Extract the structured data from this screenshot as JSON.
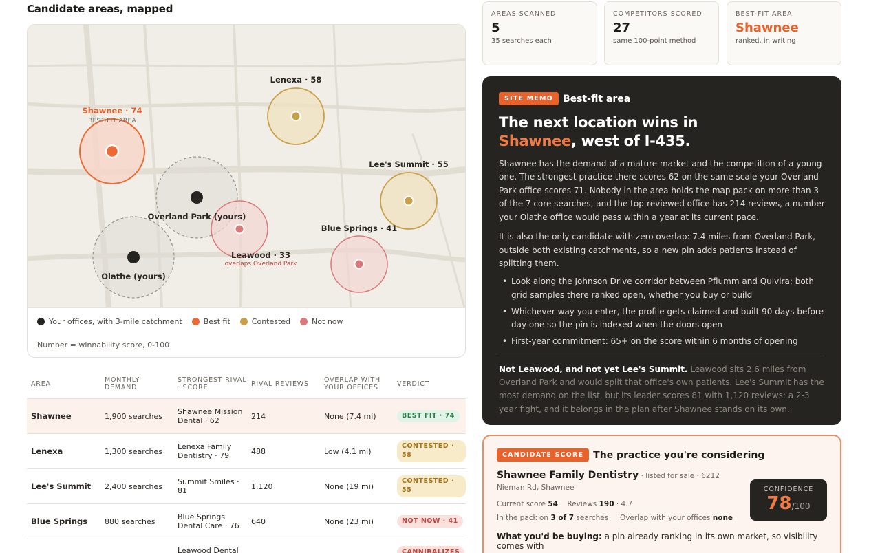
{
  "map_section": {
    "title": "Candidate areas, mapped",
    "areas": [
      {
        "label": "Shawnee · 74",
        "sub": "BEST-FIT AREA",
        "status": "best"
      },
      {
        "label": "Lenexa · 58",
        "status": "contested"
      },
      {
        "label": "Lee's Summit · 55",
        "status": "contested"
      },
      {
        "label": "Overland Park (yours)",
        "status": "yours"
      },
      {
        "label": "Blue Springs · 41",
        "status": "not-now"
      },
      {
        "label": "Leawood · 33",
        "sub": "overlaps Overland Park",
        "status": "not-now"
      },
      {
        "label": "Olathe (yours)",
        "status": "yours"
      }
    ],
    "legend": [
      {
        "label": "Your offices, with 3-mile catchment",
        "color": "#252421"
      },
      {
        "label": "Best fit",
        "color": "#ee6a35"
      },
      {
        "label": "Contested",
        "color": "#c9a04a"
      },
      {
        "label": "Not now",
        "color": "#d9797a"
      }
    ],
    "note": "Number = winnability score, 0-100"
  },
  "table": {
    "headers": [
      "AREA",
      "MONTHLY DEMAND",
      "STRONGEST RIVAL · SCORE",
      "RIVAL REVIEWS",
      "OVERLAP WITH YOUR OFFICES",
      "VERDICT"
    ],
    "rows": [
      {
        "area": "Shawnee",
        "demand": "1,900 searches",
        "rival": "Shawnee Mission Dental · 62",
        "reviews": "214",
        "overlap": "None (7.4 mi)",
        "verdict": "BEST FIT · 74",
        "kind": "best"
      },
      {
        "area": "Lenexa",
        "demand": "1,300 searches",
        "rival": "Lenexa Family Dentistry · 79",
        "reviews": "488",
        "overlap": "Low (4.1 mi)",
        "verdict": "CONTESTED · 58",
        "kind": "cont"
      },
      {
        "area": "Lee's Summit",
        "demand": "2,400 searches",
        "rival": "Summit Smiles · 81",
        "reviews": "1,120",
        "overlap": "None (19 mi)",
        "verdict": "CONTESTED · 55",
        "kind": "cont"
      },
      {
        "area": "Blue Springs",
        "demand": "880 searches",
        "rival": "Blue Springs Dental Care · 76",
        "reviews": "640",
        "overlap": "None (23 mi)",
        "verdict": "NOT NOW · 41",
        "kind": "not"
      },
      {
        "area": "",
        "demand": "",
        "rival": "Leawood Dental",
        "reviews": "",
        "overlap": "",
        "verdict": "CANNIBALIZES",
        "kind": "not"
      }
    ]
  },
  "stats": [
    {
      "label": "AREAS SCANNED",
      "value": "5",
      "sub": "35 searches each"
    },
    {
      "label": "COMPETITORS SCORED",
      "value": "27",
      "sub": "same 100-point method"
    },
    {
      "label": "BEST-FIT AREA",
      "value": "Shawnee",
      "sub": "ranked, in writing"
    }
  ],
  "memo": {
    "tag": "SITE MEMO",
    "tag_title": "Best-fit area",
    "headline_a": "The next location wins in",
    "headline_b": "Shawnee",
    "headline_c": ", west of I-435.",
    "p1": "Shawnee has the demand of a mature market and the competition of a young one. The strongest practice there scores 62 on the same scale your Overland Park office scores 71. Nobody in the area holds the map pack on more than 3 of the 7 core searches, and the top-reviewed office has 214 reviews, a number your Olathe office would pass within a year at its current pace.",
    "p2": "It is also the only candidate with zero overlap: 7.4 miles from Overland Park, outside both existing catchments, so a new pin adds patients instead of splitting them.",
    "bullets": [
      "Look along the Johnson Drive corridor between Pflumm and Quivira; both grid samples there ranked open, whether you buy or build",
      "Whichever way you enter, the profile gets claimed and built 90 days before day one so the pin is indexed when the doors open",
      "First-year commitment: 65+ on the score within 6 months of opening"
    ],
    "foot_bold": "Not Leawood, and not yet Lee's Summit.",
    "foot_text": " Leawood sits 2.6 miles from Overland Park and would split that office's own patients. Lee's Summit has the most demand on the list, but its leader scores 81 with 1,120 reviews: a 2-3 year fight, and it belongs in the plan after Shawnee stands on its own."
  },
  "candidate": {
    "tag": "CANDIDATE SCORE",
    "tag_title": "The practice you're considering",
    "name": "Shawnee Family Dentistry",
    "name_sub": " · listed for sale · 6212",
    "address": "Nieman Rd, Shawnee",
    "current_score_label": "Current score",
    "current_score": "54",
    "reviews_label": "Reviews",
    "reviews": "190",
    "rating": " · 4.7",
    "pack_label_a": "In the pack on ",
    "pack_value": "3 of 7",
    "pack_label_b": " searches",
    "overlap_label": "Overlap with your offices ",
    "overlap_value": "none",
    "confidence_label": "CONFIDENCE",
    "confidence_value": "78",
    "confidence_max": "/100",
    "buy_bold": "What you'd be buying:",
    "buy_text": " a pin already ranking in its own market, so visibility comes with"
  }
}
